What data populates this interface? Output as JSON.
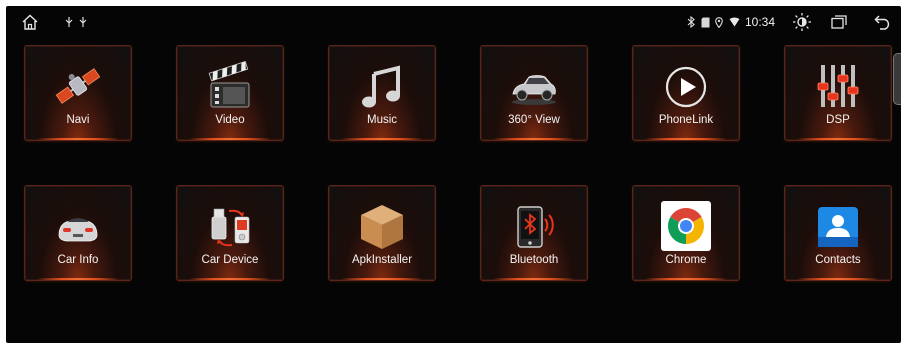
{
  "status_bar": {
    "time": "10:34",
    "left_icons": [
      "home-icon",
      "usb-icon",
      "usb-icon"
    ],
    "right_icons": [
      "bluetooth-icon",
      "sd-card-icon",
      "location-icon",
      "wifi-icon",
      "brightness-icon",
      "window-icon",
      "back-icon"
    ]
  },
  "apps": [
    {
      "label": "Navi",
      "icon": "satellite-icon"
    },
    {
      "label": "Video",
      "icon": "clapperboard-icon"
    },
    {
      "label": "Music",
      "icon": "music-note-icon"
    },
    {
      "label": "360° View",
      "icon": "car-360-icon"
    },
    {
      "label": "PhoneLink",
      "icon": "play-circle-icon"
    },
    {
      "label": "DSP",
      "icon": "equalizer-icon"
    },
    {
      "label": "Car Info",
      "icon": "car-front-icon"
    },
    {
      "label": "Car Device",
      "icon": "usb-device-icon"
    },
    {
      "label": "ApkInstaller",
      "icon": "package-box-icon"
    },
    {
      "label": "Bluetooth",
      "icon": "bluetooth-phone-icon"
    },
    {
      "label": "Chrome",
      "icon": "chrome-icon"
    },
    {
      "label": "Contacts",
      "icon": "contacts-icon"
    }
  ],
  "colors": {
    "accent": "#ff5a1e",
    "tile_border": "#5a2418",
    "background": "#050505"
  }
}
